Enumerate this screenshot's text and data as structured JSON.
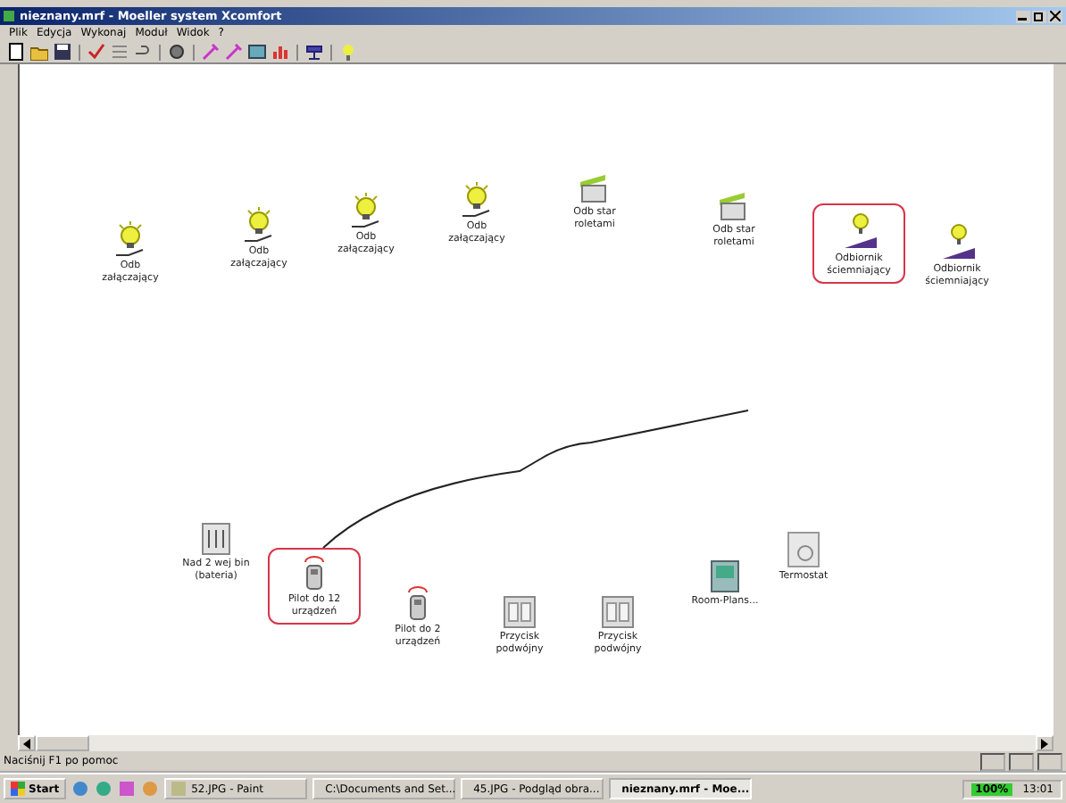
{
  "window": {
    "title": "nieznany.mrf - Moeller system Xcomfort"
  },
  "menu": [
    "Plik",
    "Edycja",
    "Wykonaj",
    "Moduł",
    "Widok",
    "?"
  ],
  "devices": [
    {
      "kind": "bulb",
      "label": "Odb załączający",
      "selected": false
    },
    {
      "kind": "bulb",
      "label": "Odb załączający",
      "selected": false
    },
    {
      "kind": "bulb",
      "label": "Odb załączający",
      "selected": false
    },
    {
      "kind": "bulb",
      "label": "Odb załączający",
      "selected": false
    },
    {
      "kind": "blind",
      "label": "Odb star roletami",
      "selected": false
    },
    {
      "kind": "blind",
      "label": "Odb star roletami",
      "selected": false
    },
    {
      "kind": "dimmer",
      "label": "Odbiornik ściemniający",
      "selected": true
    },
    {
      "kind": "dimmer",
      "label": "Odbiornik ściemniający",
      "selected": false
    },
    {
      "kind": "binary",
      "label": "Nad 2 wej bin (bateria)",
      "selected": false
    },
    {
      "kind": "remote",
      "label": "Pilot do 12 urządzeń",
      "selected": true
    },
    {
      "kind": "remote",
      "label": "Pilot do 2 urządzeń",
      "selected": false
    },
    {
      "kind": "push",
      "label": "Przycisk podwójny",
      "selected": false
    },
    {
      "kind": "push",
      "label": "Przycisk podwójny",
      "selected": false
    },
    {
      "kind": "room",
      "label": "Room-Plans...",
      "selected": false
    },
    {
      "kind": "thermo",
      "label": "Termostat",
      "selected": false
    }
  ],
  "status_bar": "Naciśnij F1 po pomoc",
  "taskbar": {
    "start": "Start",
    "tasks": [
      {
        "label": "52.JPG - Paint",
        "selected": false
      },
      {
        "label": "C:\\Documents and Set...",
        "selected": false
      },
      {
        "label": "45.JPG - Podgląd obra...",
        "selected": false
      },
      {
        "label": "nieznany.mrf - Moe...",
        "selected": true
      }
    ],
    "battery": "100%",
    "clock": "13:01"
  }
}
